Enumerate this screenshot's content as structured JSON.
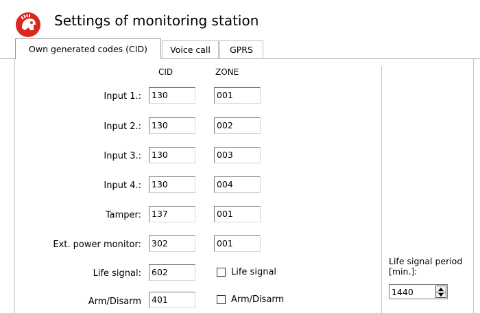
{
  "header": {
    "title": "Settings of monitoring station",
    "logo_icon": "helmet-icon",
    "logo_color": "#d9281f"
  },
  "tabs": [
    {
      "label": "Own generated codes (CID)",
      "active": true
    },
    {
      "label": "Voice call",
      "active": false
    },
    {
      "label": "GPRS",
      "active": false
    }
  ],
  "columns": {
    "cid": "CID",
    "zone": "ZONE"
  },
  "rows": [
    {
      "label": "Input 1.:",
      "cid": "130",
      "zone": "001"
    },
    {
      "label": "Input 2.:",
      "cid": "130",
      "zone": "002"
    },
    {
      "label": "Input 3.:",
      "cid": "130",
      "zone": "003"
    },
    {
      "label": "Input 4.:",
      "cid": "130",
      "zone": "004"
    },
    {
      "label": "Tamper:",
      "cid": "137",
      "zone": "001"
    },
    {
      "label": "Ext. power monitor:",
      "cid": "302",
      "zone": "001"
    },
    {
      "label": "Life signal:",
      "cid": "602",
      "check_label": "Life signal",
      "checked": false
    },
    {
      "label": "Arm/Disarm",
      "cid": "401",
      "check_label": "Arm/Disarm",
      "checked": false
    }
  ],
  "life_signal_period": {
    "label": "Life signal period [min.]:",
    "value": "1440"
  }
}
